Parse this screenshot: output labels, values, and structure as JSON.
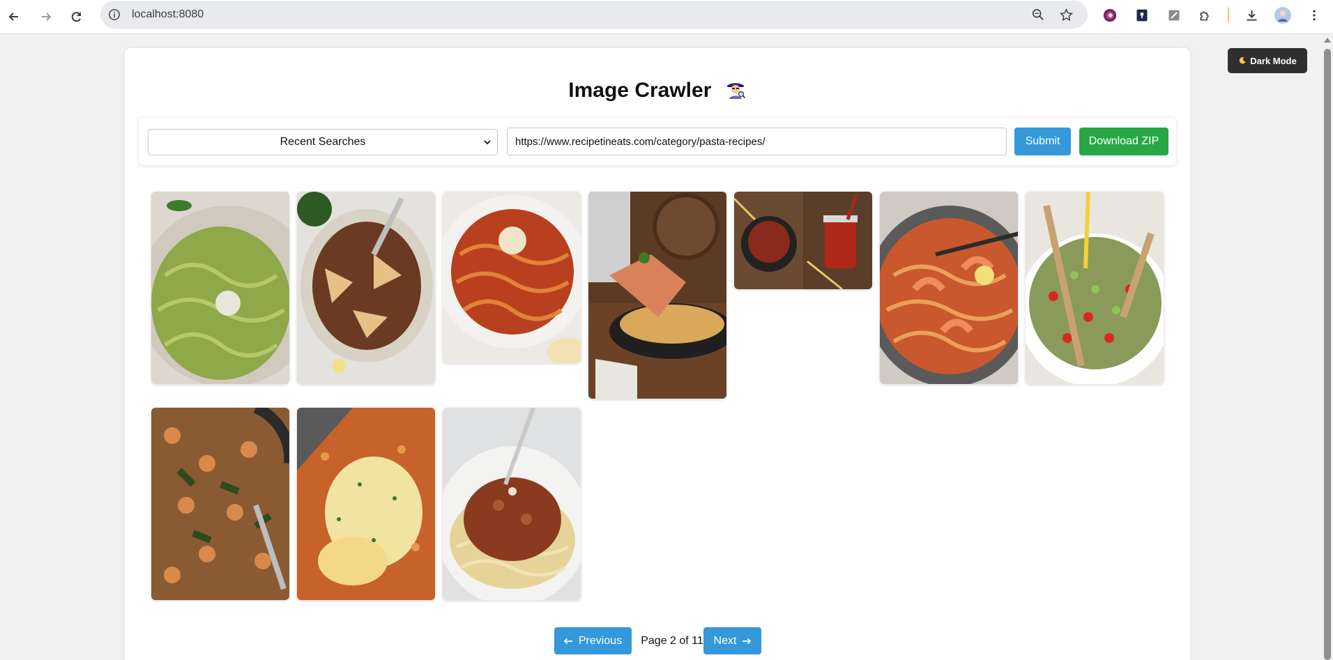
{
  "browser": {
    "url": "localhost:8080"
  },
  "theme_toggle": {
    "icon": "moon-icon",
    "label": "Dark Mode"
  },
  "app": {
    "title": "Image Crawler",
    "title_icon": "detective-icon"
  },
  "controls": {
    "recent_searches": {
      "selected": "Recent Searches"
    },
    "url_input": {
      "value": "https://www.recipetineats.com/category/pasta-recipes/"
    },
    "submit_label": "Submit",
    "download_label": "Download ZIP"
  },
  "gallery": {
    "images": [
      {
        "name": "pesto-spaghetti-image"
      },
      {
        "name": "beef-ragu-pappardelle-image"
      },
      {
        "name": "spaghetti-tomato-sauce-image"
      },
      {
        "name": "lasagna-skillet-image"
      },
      {
        "name": "tomato-sauce-jar-image"
      },
      {
        "name": "prawn-pasta-image"
      },
      {
        "name": "pearl-couscous-salad-image"
      },
      {
        "name": "pasta-shells-spinach-image"
      },
      {
        "name": "cheesy-macaroni-bake-image"
      },
      {
        "name": "spaghetti-bolognese-image"
      }
    ]
  },
  "pagination": {
    "prev_icon": "arrow-left-icon",
    "prev_label": "Previous",
    "status": "Page 2 of 11",
    "next_label": "Next",
    "next_icon": "arrow-right-icon",
    "current_page": 2,
    "total_pages": 11
  },
  "colors": {
    "primary": "#3498db",
    "success": "#28a745",
    "dark_toggle": "#2f2f2f",
    "page_bg": "#f1f1f1"
  }
}
